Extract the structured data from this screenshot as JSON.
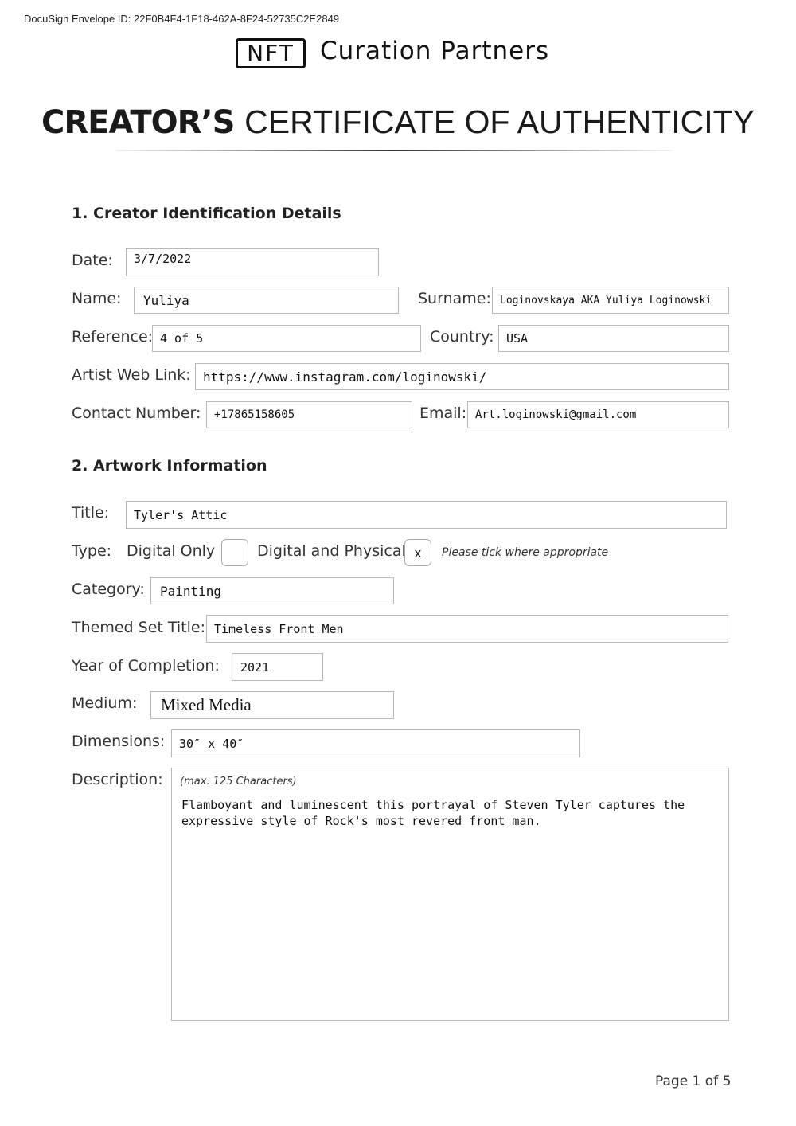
{
  "envelope_id": "DocuSign Envelope ID: 22F0B4F4-1F18-462A-8F24-52735C2E2849",
  "logo": {
    "box_text": "NFT",
    "text": "Curation Partners"
  },
  "title": {
    "bold": "CREATOR’S",
    "rest": "CERTIFICATE OF AUTHENTICITY"
  },
  "section1": {
    "heading": "1. Creator Identification Details",
    "date": {
      "label": "Date:",
      "value": "3/7/2022"
    },
    "name": {
      "label": "Name:",
      "value": "Yuliya"
    },
    "surname": {
      "label": "Surname:",
      "value": "Loginovskaya AKA Yuliya Loginowski"
    },
    "reference": {
      "label": "Reference:",
      "value": "4 of 5"
    },
    "country": {
      "label": "Country:",
      "value": "USA"
    },
    "web_link": {
      "label": "Artist Web Link:",
      "value": "https://www.instagram.com/loginowski/"
    },
    "contact": {
      "label": "Contact Number:",
      "value": "+17865158605"
    },
    "email": {
      "label": "Email:",
      "value": "Art.loginowski@gmail.com"
    }
  },
  "section2": {
    "heading": "2. Artwork Information",
    "title": {
      "label": "Title:",
      "value": "Tyler's Attic"
    },
    "type": {
      "label": "Type:",
      "digital_only": {
        "label": "Digital Only",
        "value": ""
      },
      "digital_physical": {
        "label": "Digital and Physical",
        "value": "x"
      },
      "hint": "Please tick where appropriate"
    },
    "category": {
      "label": "Category:",
      "value": "Painting"
    },
    "themed_set": {
      "label": "Themed Set Title:",
      "value": "Timeless Front Men"
    },
    "year": {
      "label": "Year of Completion:",
      "value": "2021"
    },
    "medium": {
      "label": "Medium:",
      "value": "Mixed Media"
    },
    "dimensions": {
      "label": "Dimensions:",
      "value": "30″ x 40″"
    },
    "description": {
      "label": "Description:",
      "hint": "(max. 125 Characters)",
      "value": "Flamboyant and luminescent this portrayal of Steven Tyler captures the expressive style of Rock's most revered front man."
    }
  },
  "footer": {
    "page": "Page 1 of 5"
  }
}
